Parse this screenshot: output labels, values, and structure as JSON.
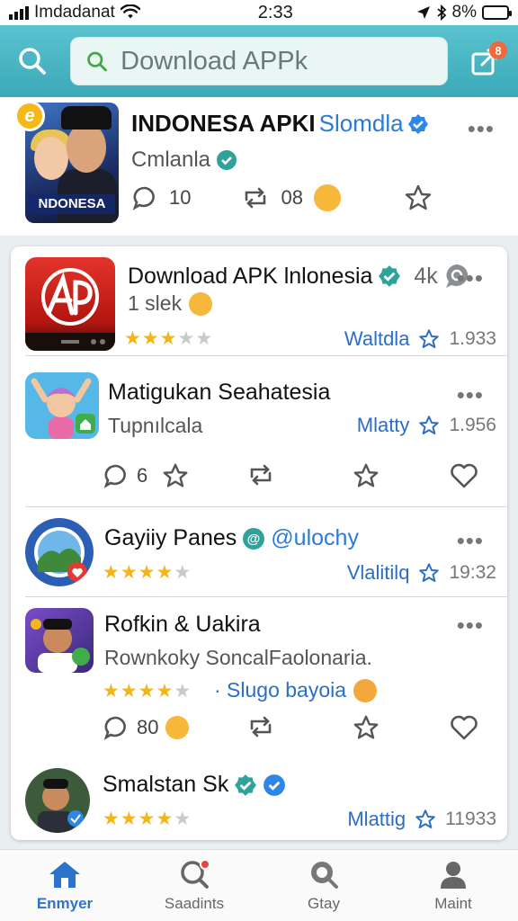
{
  "status_bar": {
    "carrier": "Imdadanat",
    "time": "2:33",
    "battery": "8%"
  },
  "header": {
    "search_placeholder": "Download APPk",
    "notification_count": "8"
  },
  "featured": {
    "badge_letter": "e",
    "thumb_label": "NDONESA",
    "title": "INDONESA APKI",
    "title_suffix": "Slomdla",
    "developer": "Cmlanla",
    "comments": "10",
    "reposts": "08"
  },
  "list": [
    {
      "name": "Download APK lnlonesia",
      "extra": "4k",
      "subline": "1 slek",
      "rating": 3,
      "link": "Waltdla",
      "number": "1.933",
      "colors": {
        "accent": "#d8231e"
      }
    },
    {
      "name": "Matigukan Seahatesia",
      "subline": "Tupnılcala",
      "link": "Mlatty",
      "number": "1.956",
      "comments": "6"
    },
    {
      "name": "Gayiiy Panes",
      "handle": "@ulochy",
      "rating": 4,
      "link": "Vlalitilq",
      "number": "19:32"
    },
    {
      "name": "Rofkin & Uakira",
      "subline": "Rownkoky SoncalFaolonaria.",
      "rating": 4,
      "tag": "· Slugo bayoia",
      "comments": "80"
    },
    {
      "name": "Smalstan Sk",
      "rating": 4,
      "link": "Mlattig",
      "number": "11933"
    }
  ],
  "nav": {
    "tabs": [
      {
        "label": "Enmyer",
        "active": true
      },
      {
        "label": "Saadints"
      },
      {
        "label": "Gtay"
      },
      {
        "label": "Maint"
      }
    ]
  },
  "colors": {
    "header_teal": "#3aa9b8",
    "link_blue": "#2a6ec7",
    "star_gold": "#f2b51c",
    "verified_teal": "#2fa39b",
    "verified_blue": "#2e86e6"
  }
}
